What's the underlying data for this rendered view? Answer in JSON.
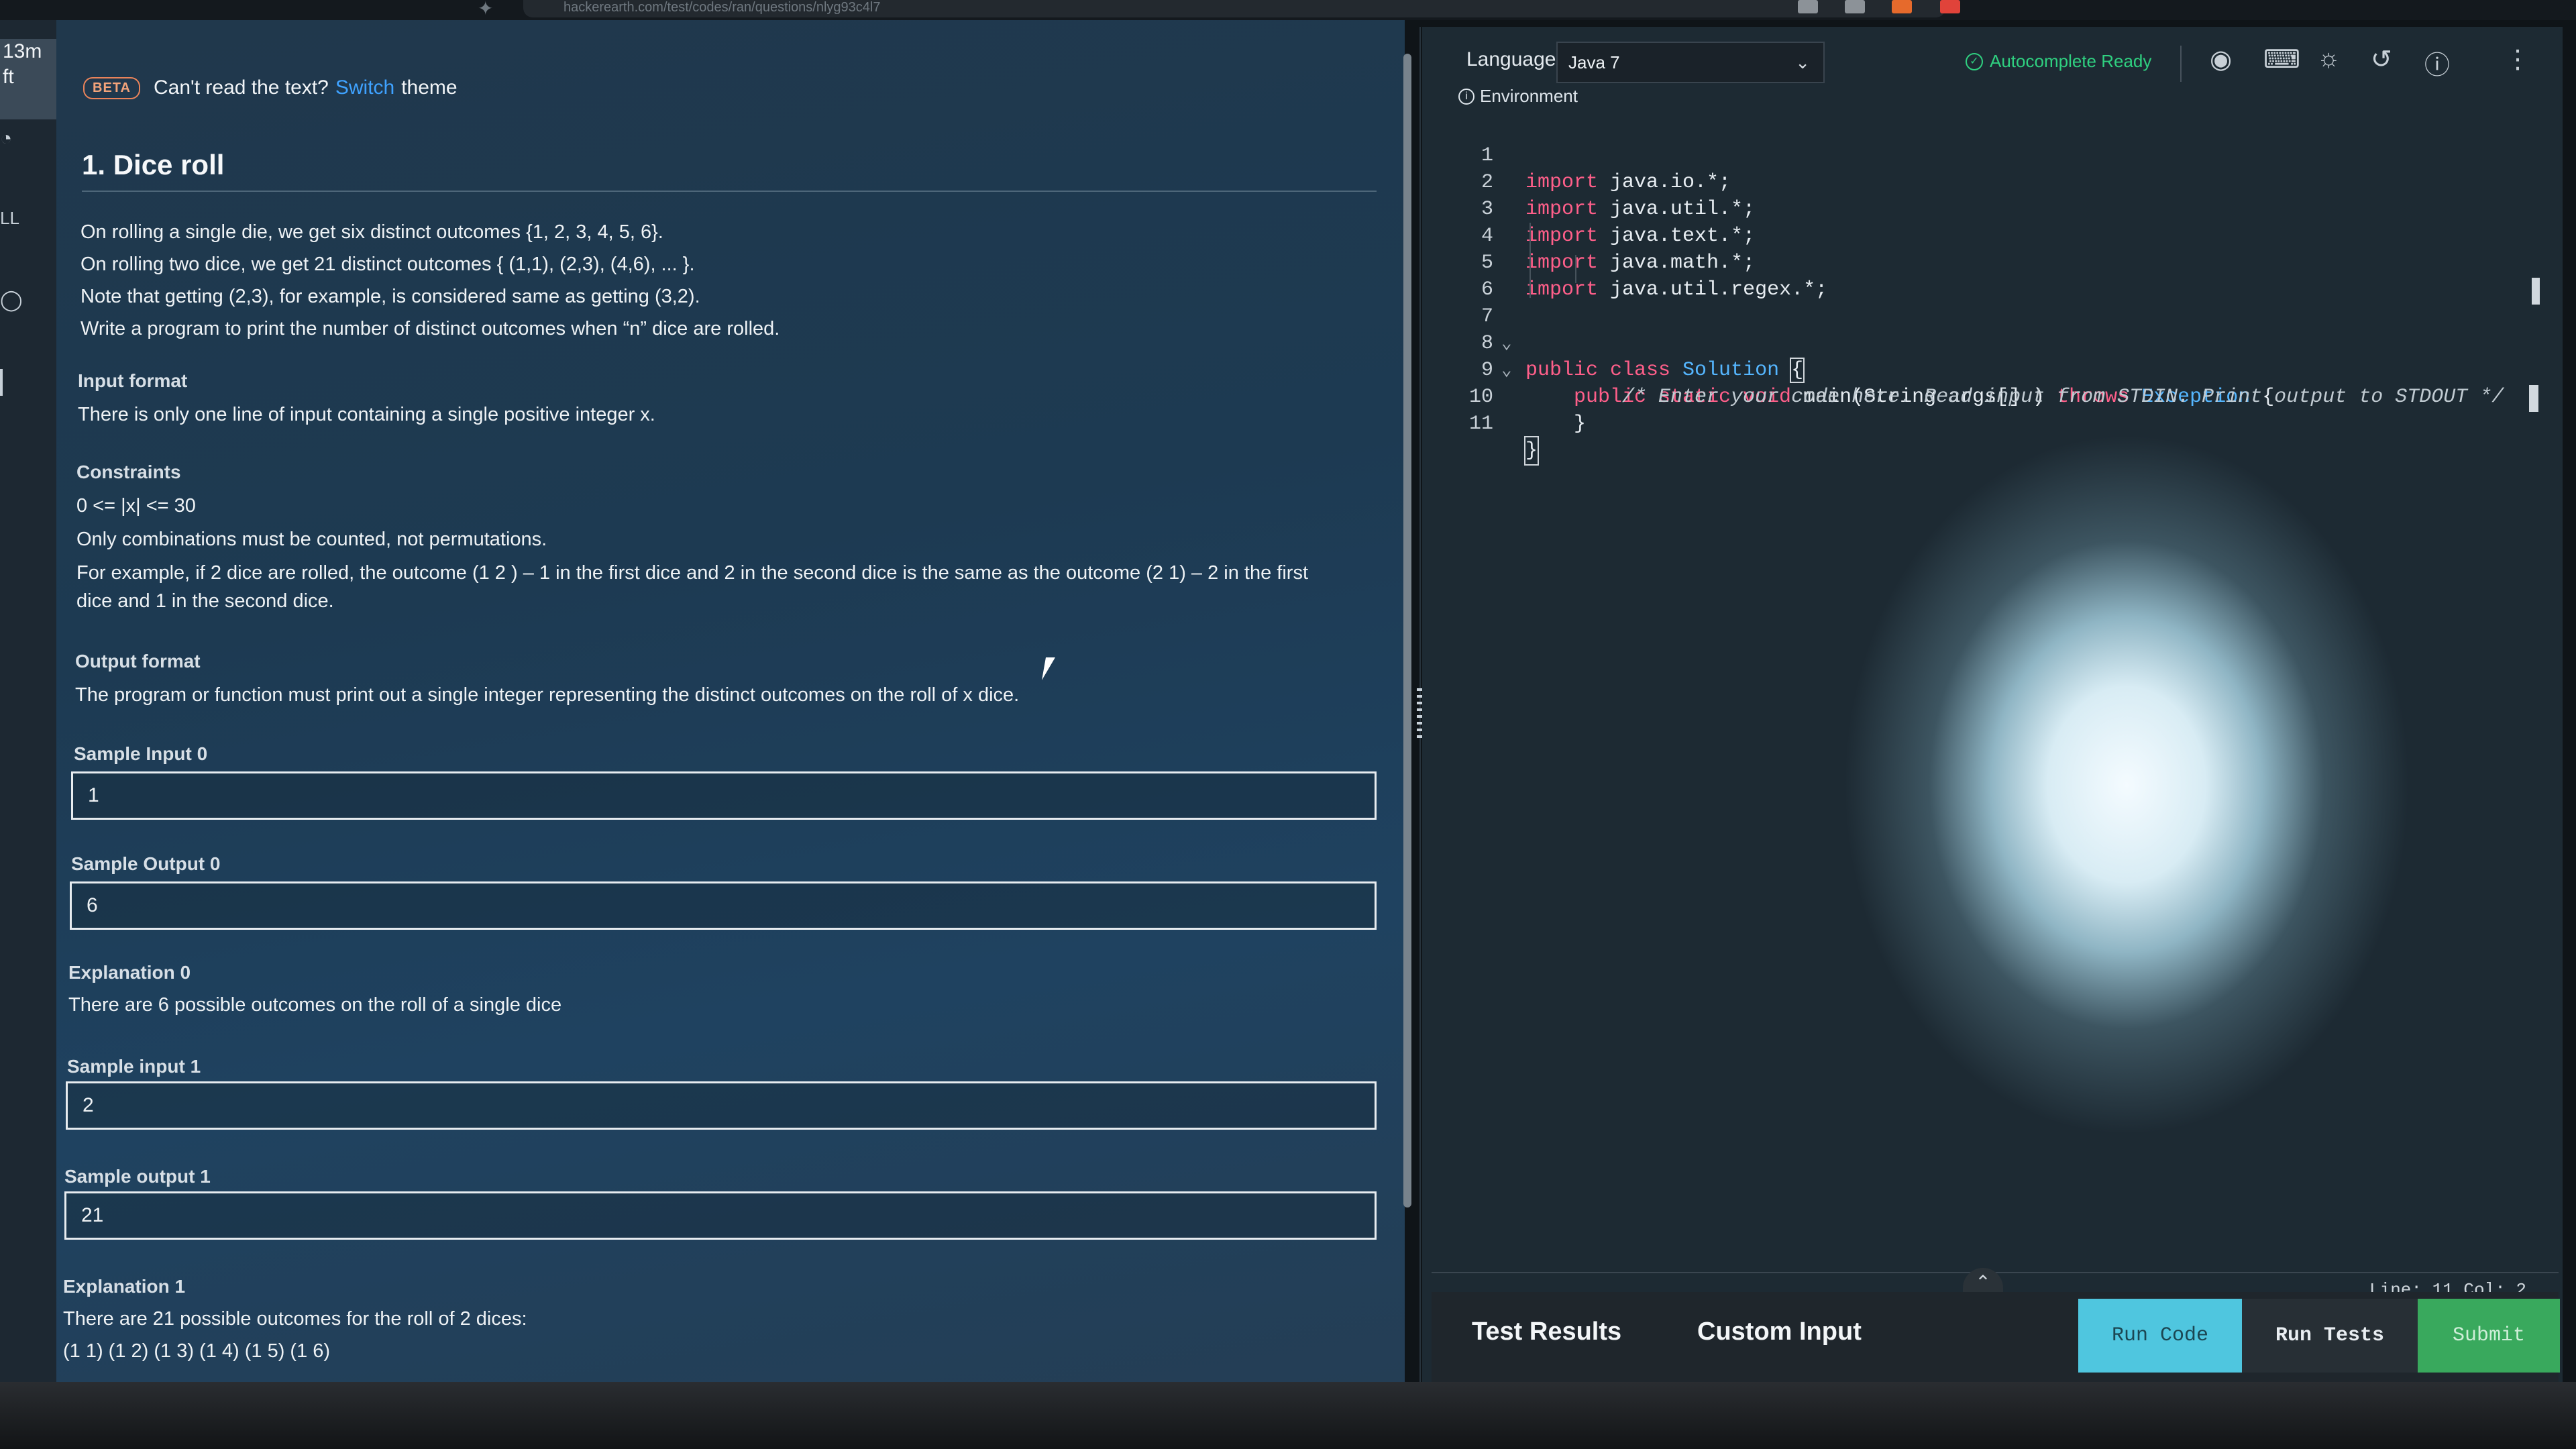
{
  "browser": {
    "url": "hackerearth.com/test/codes/ran/questions/nlyg93c4l7"
  },
  "timer": {
    "line1": "13m",
    "line2": "ft"
  },
  "rail": {
    "labels": [
      "LL"
    ]
  },
  "banner": {
    "badge": "BETA",
    "text_before": "Can't read the text?",
    "link": "Switch",
    "text_after": "theme"
  },
  "problem": {
    "title": "1. Dice roll",
    "description": [
      "On rolling a single die, we get six distinct outcomes {1, 2, 3, 4, 5, 6}.",
      "On rolling two dice, we get 21 distinct outcomes { (1,1), (2,3), (4,6), ... }.",
      "Note that getting (2,3), for example, is considered same as getting (3,2).",
      "Write a program to print the number of distinct outcomes when “n” dice are rolled."
    ],
    "input_format_heading": "Input format",
    "input_format": "There is only one line of input containing a single positive integer x.",
    "constraints_heading": "Constraints",
    "constraints": [
      "0 <= |x| <= 30",
      "Only combinations must be counted, not permutations.",
      "For example, if 2 dice are rolled, the outcome (1 2 ) – 1 in the first dice and 2 in the second dice is the same as the outcome (2 1) – 2 in the first",
      "dice and 1 in the second dice."
    ],
    "output_format_heading": "Output format",
    "output_format": "The program or function must print out a single integer representing the distinct outcomes on the roll of x dice.",
    "samples": [
      {
        "label": "Sample Input 0",
        "value": "1"
      },
      {
        "label": "Sample Output 0",
        "value": "6"
      },
      {
        "label": "Sample input 1",
        "value": "2"
      },
      {
        "label": "Sample output 1",
        "value": "21"
      }
    ],
    "explanation0_heading": "Explanation 0",
    "explanation0": "There are 6 possible outcomes on the roll of a single dice",
    "explanation1_heading": "Explanation 1",
    "explanation1": "There are 21 possible outcomes for the roll of 2 dices:",
    "explanation1_list": "(1 1) (1 2) (1 3) (1 4) (1 5) (1 6)"
  },
  "editor": {
    "language_label": "Language",
    "language_value": "Java 7",
    "autocomplete": "Autocomplete Ready",
    "environment": "Environment",
    "header_icons": [
      "eye-icon",
      "keyboard-icon",
      "sun-icon",
      "history-icon",
      "help-icon",
      "more-icon"
    ],
    "status": "Line: 11 Col: 2",
    "line_numbers": [
      "1",
      "2",
      "3",
      "4",
      "5",
      "6",
      "7",
      "8",
      "9",
      "10",
      "11"
    ],
    "code": {
      "l1_kw": "import",
      "l1_rest": " java.io.*;",
      "l2_kw": "import",
      "l2_rest": " java.util.*;",
      "l3_kw": "import",
      "l3_rest": " java.text.*;",
      "l4_kw": "import",
      "l4_rest": " java.math.*;",
      "l5_kw": "import",
      "l5_rest": " java.util.regex.*;",
      "l7_kw": "public class",
      "l7_type": " Solution",
      "l7_brace": "{",
      "l8_kw": "    public static void",
      "l8_name": " main(String args[] )",
      "l8_throws": " throws",
      "l8_type": " Exception",
      "l8_brace": " {",
      "l9_comment": "        /* Enter your code here. Read input from STDIN. Print output to STDOUT */",
      "l10": "    }",
      "l11": "}"
    }
  },
  "bottom": {
    "tab_results": "Test Results",
    "tab_custom": "Custom Input",
    "run_code": "Run Code",
    "run_tests": "Run Tests",
    "submit": "Submit"
  },
  "colors": {
    "accent": "#3fa2ff",
    "keyword": "#ff5f8a",
    "type": "#55b6ff",
    "submit": "#39a95d",
    "run_code": "#4fc6df"
  }
}
